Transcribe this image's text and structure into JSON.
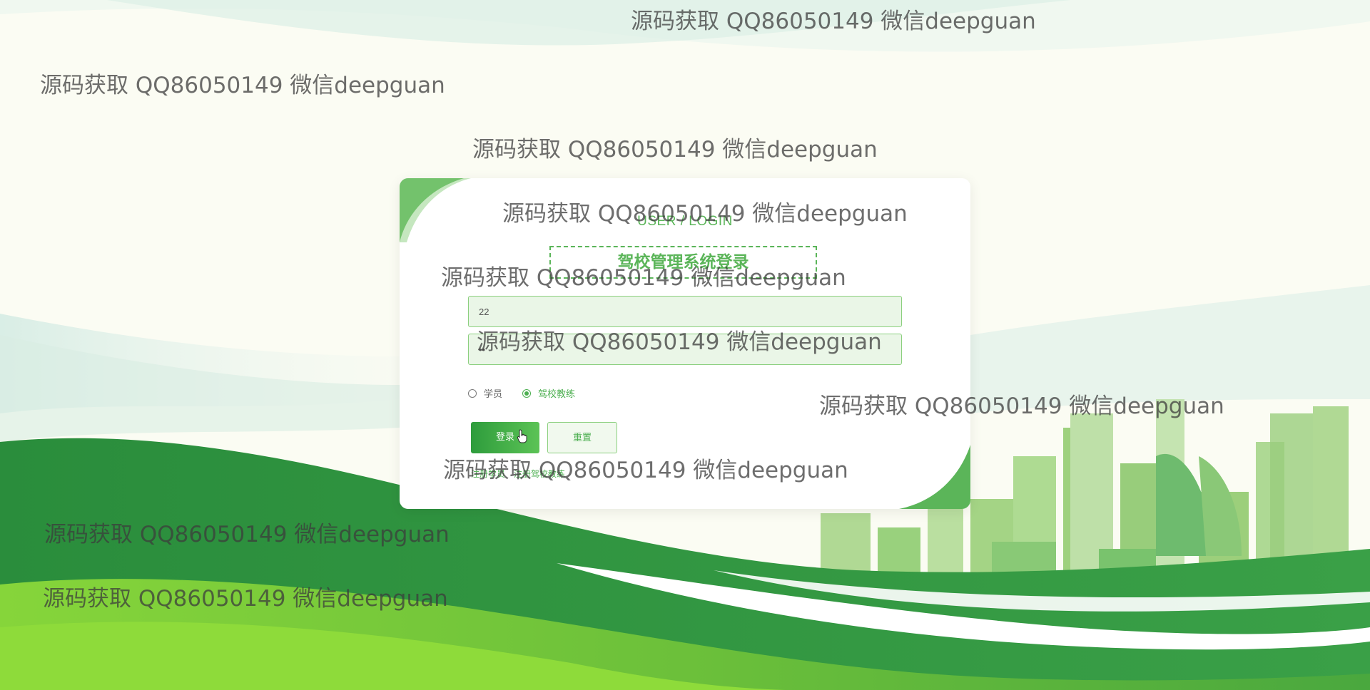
{
  "watermark_text": "源码获取 QQ86050149 微信deepguan",
  "login": {
    "subtitle": "USER / LOGIN",
    "title": "驾校管理系统登录",
    "username_value": "22",
    "password_value": "••",
    "roles": [
      {
        "label": "学员",
        "checked": false
      },
      {
        "label": "驾校教练",
        "checked": true
      }
    ],
    "login_button": "登录",
    "reset_button": "重置",
    "register_student": "注册学员",
    "register_coach": "注册驾校教练"
  },
  "colors": {
    "accent": "#4caf50",
    "dark_green": "#2e9c3c",
    "light_green": "#8bd84a",
    "background": "#fbfcf3"
  }
}
